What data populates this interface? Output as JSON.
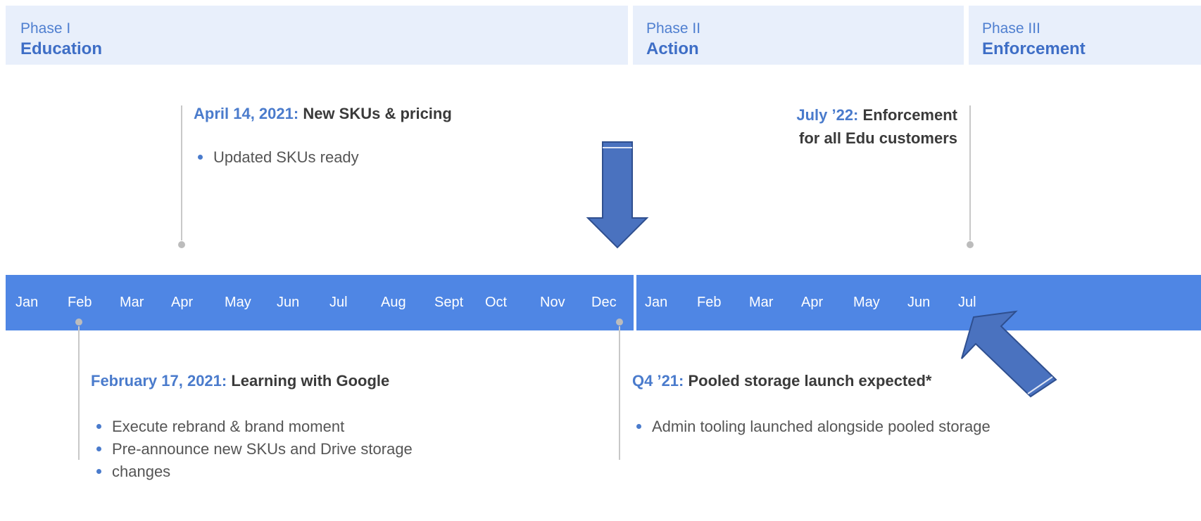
{
  "phases": [
    {
      "num": "Phase I",
      "name": "Education"
    },
    {
      "num": "Phase II",
      "name": "Action"
    },
    {
      "num": "Phase III",
      "name": "Enforcement"
    }
  ],
  "months_year1": [
    "Jan",
    "Feb",
    "Mar",
    "Apr",
    "May",
    "Jun",
    "Jul",
    "Aug",
    "Sept",
    "Oct",
    "Nov",
    "Dec"
  ],
  "months_year2": [
    "Jan",
    "Feb",
    "Mar",
    "Apr",
    "May",
    "Jun",
    "Jul"
  ],
  "events": {
    "april": {
      "date": "April 14, 2021:",
      "title": "New SKUs & pricing",
      "bullets": [
        "Updated SKUs ready"
      ]
    },
    "july22": {
      "date": "July ’22:",
      "title_line1": "Enforcement",
      "title_line2": "for all Edu customers"
    },
    "february": {
      "date": "February 17, 2021:",
      "title": "Learning with Google",
      "bullets": [
        "Execute rebrand & brand moment",
        "Pre-announce new SKUs and Drive storage",
        "changes"
      ]
    },
    "q4": {
      "date": "Q4 ’21:",
      "title": "Pooled storage launch expected*",
      "bullets": [
        "Admin tooling launched alongside pooled storage"
      ]
    }
  },
  "colors": {
    "timeline_bar": "#4f86e4",
    "phase_bg": "#e8effb",
    "accent_text": "#4a7bcc",
    "arrow_fill": "#4a72bf",
    "arrow_stroke": "#2f4f8f"
  }
}
